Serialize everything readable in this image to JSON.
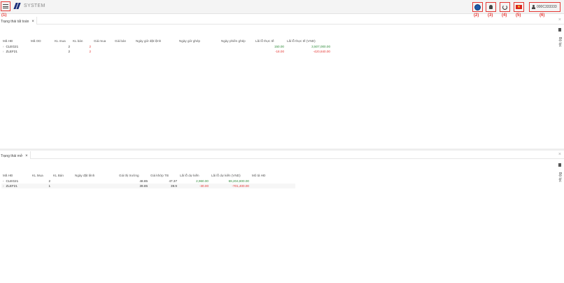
{
  "topbar": {
    "annotations": [
      "(1)",
      "(2)",
      "(3)",
      "(4)",
      "(5)",
      "(6)"
    ],
    "logo_text": "SYSTEM",
    "flag_star": "★",
    "user_id": "000C333333"
  },
  "panel1": {
    "tab_label": "Trạng thái tất toán",
    "tab_close": "×",
    "close": "×",
    "filter_label": "Bộ lọc",
    "columns": [
      "Mã HĐ",
      "Mã OD",
      "KL mua",
      "KL bán",
      "Giá mua",
      "Giá bán",
      "Ngày giờ đặt lệnh",
      "Ngày giờ ghép",
      "Ngày phiên ghép",
      "Lãi lỗ thực tế",
      "Lãi lỗ thực tế (VND)"
    ],
    "rows": [
      {
        "expand": "›",
        "code": "CLEG21",
        "od": "",
        "kl_mua": "2",
        "kl_ban": "2",
        "gia_mua": "",
        "gia_ban": "",
        "ngay_dat": "",
        "ngay_ghep": "",
        "ngay_phien": "",
        "lai_lo": "150.00",
        "lai_lo_vnd": "3,507,000.00"
      },
      {
        "expand": "›",
        "code": "ZLEF21",
        "od": "",
        "kl_mua": "2",
        "kl_ban": "2",
        "gia_mua": "",
        "gia_ban": "",
        "ngay_dat": "",
        "ngay_ghep": "",
        "ngay_phien": "",
        "lai_lo": "-18.00",
        "lai_lo_vnd": "-420,840.00"
      }
    ]
  },
  "panel2": {
    "tab_label": "Trạng thái mở",
    "tab_close": "×",
    "close": "×",
    "filter_label": "Bộ lọc",
    "columns": [
      "Mã HĐ",
      "KL Mua",
      "KL Bán",
      "Ngày đặt lệnh",
      "Giá thị trường",
      "Giá khớp TB",
      "Lãi lỗ dự kiến",
      "Lãi lỗ dự kiến (VND)",
      "Mô tả HĐ"
    ],
    "rows": [
      {
        "expand": "›",
        "code": "CLEG21",
        "kl_mua": "2",
        "kl_ban": "",
        "ngay_dat": "",
        "gia_tt": "48.85",
        "gia_khop": "47.37",
        "lai_lo": "2,960.00",
        "lai_lo_vnd": "69,204,800.00",
        "mo_ta": ""
      },
      {
        "expand": "›",
        "code": "ZLEF21",
        "kl_mua": "1",
        "kl_ban": "",
        "ngay_dat": "",
        "gia_tt": "39.85",
        "gia_khop": "39.9",
        "lai_lo": "-30.00",
        "lai_lo_vnd": "-701,400.00",
        "mo_ta": ""
      }
    ]
  },
  "colors": {
    "accent_red": "#e53935",
    "positive": "#2e8b3a",
    "brand_blue": "#1a2f7a"
  }
}
